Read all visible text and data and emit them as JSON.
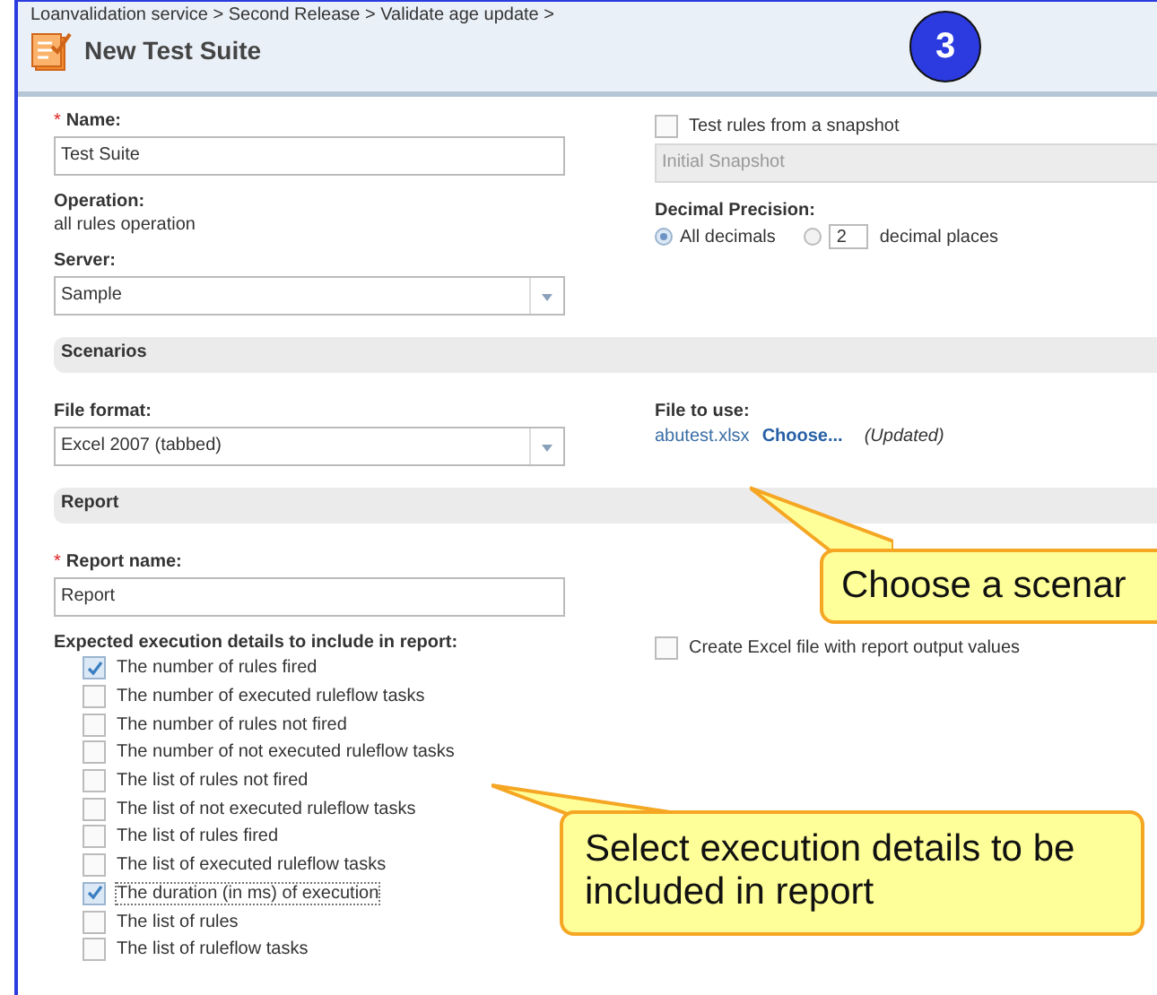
{
  "breadcrumb": "Loanvalidation service > Second Release > Validate age update >",
  "title": "New Test Suite",
  "step_badge": "3",
  "name": {
    "required_mark": "*",
    "label": "Name:",
    "value": "Test Suite"
  },
  "operation": {
    "label": "Operation:",
    "value": "all rules operation"
  },
  "server": {
    "label": "Server:",
    "value": "Sample"
  },
  "snapshot": {
    "label": "Test rules from a snapshot",
    "checked": false,
    "value": "Initial Snapshot",
    "disabled": true
  },
  "decimal_precision": {
    "label": "Decimal Precision:",
    "options": [
      {
        "label": "All decimals",
        "selected": true
      },
      {
        "label": "decimal places",
        "selected": false,
        "value": "2"
      }
    ]
  },
  "scenarios": {
    "title": "Scenarios",
    "file_format": {
      "label": "File format:",
      "value": "Excel 2007 (tabbed)"
    },
    "file_to_use": {
      "label": "File to use:",
      "file": "abutest.xlsx",
      "choose": "Choose...",
      "status": "(Updated)"
    }
  },
  "report": {
    "title": "Report",
    "report_name": {
      "required_mark": "*",
      "label": "Report name:",
      "value": "Report"
    },
    "details_label": "Expected execution details to include in report:",
    "details": [
      {
        "label": "The number of rules fired",
        "checked": true,
        "focused": false
      },
      {
        "label": "The number of executed ruleflow tasks",
        "checked": false,
        "focused": false
      },
      {
        "label": "The number of rules not fired",
        "checked": false,
        "focused": false
      },
      {
        "label": "The number of not executed ruleflow tasks",
        "checked": false,
        "focused": false
      },
      {
        "label": "The list of rules not fired",
        "checked": false,
        "focused": false
      },
      {
        "label": "The list of not executed ruleflow tasks",
        "checked": false,
        "focused": false
      },
      {
        "label": "The list of rules fired",
        "checked": false,
        "focused": false
      },
      {
        "label": "The list of executed ruleflow tasks",
        "checked": false,
        "focused": false
      },
      {
        "label": "The duration (in ms) of execution",
        "checked": true,
        "focused": true
      },
      {
        "label": "The list of rules",
        "checked": false,
        "focused": false
      },
      {
        "label": "The list of ruleflow tasks",
        "checked": false,
        "focused": false
      }
    ],
    "excel_output": {
      "label": "Create Excel file with report output values",
      "checked": false
    }
  },
  "callouts": [
    {
      "text": "Choose a scenar"
    },
    {
      "text": "Select execution details to be included in report"
    }
  ]
}
